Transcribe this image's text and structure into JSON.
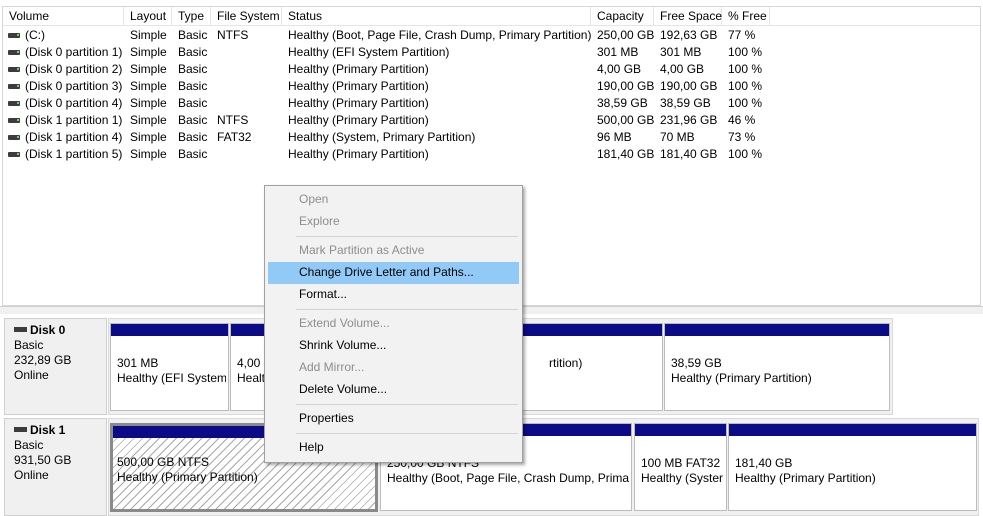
{
  "columns": [
    "Volume",
    "Layout",
    "Type",
    "File System",
    "Status",
    "Capacity",
    "Free Space",
    "% Free"
  ],
  "volumes": [
    {
      "volume": "(C:)",
      "layout": "Simple",
      "type": "Basic",
      "fs": "NTFS",
      "status": "Healthy (Boot, Page File, Crash Dump, Primary Partition)",
      "capacity": "250,00 GB",
      "free": "192,63 GB",
      "pct": "77 %"
    },
    {
      "volume": "(Disk 0 partition 1)",
      "layout": "Simple",
      "type": "Basic",
      "fs": "",
      "status": "Healthy (EFI System Partition)",
      "capacity": "301 MB",
      "free": "301 MB",
      "pct": "100 %"
    },
    {
      "volume": "(Disk 0 partition 2)",
      "layout": "Simple",
      "type": "Basic",
      "fs": "",
      "status": "Healthy (Primary Partition)",
      "capacity": "4,00 GB",
      "free": "4,00 GB",
      "pct": "100 %"
    },
    {
      "volume": "(Disk 0 partition 3)",
      "layout": "Simple",
      "type": "Basic",
      "fs": "",
      "status": "Healthy (Primary Partition)",
      "capacity": "190,00 GB",
      "free": "190,00 GB",
      "pct": "100 %"
    },
    {
      "volume": "(Disk 0 partition 4)",
      "layout": "Simple",
      "type": "Basic",
      "fs": "",
      "status": "Healthy (Primary Partition)",
      "capacity": "38,59 GB",
      "free": "38,59 GB",
      "pct": "100 %"
    },
    {
      "volume": "(Disk 1 partition 1)",
      "layout": "Simple",
      "type": "Basic",
      "fs": "NTFS",
      "status": "Healthy (Primary Partition)",
      "capacity": "500,00 GB",
      "free": "231,96 GB",
      "pct": "46 %"
    },
    {
      "volume": "(Disk 1 partition 4)",
      "layout": "Simple",
      "type": "Basic",
      "fs": "FAT32",
      "status": "Healthy (System, Primary Partition)",
      "capacity": "96 MB",
      "free": "70 MB",
      "pct": "73 %"
    },
    {
      "volume": "(Disk 1 partition 5)",
      "layout": "Simple",
      "type": "Basic",
      "fs": "",
      "status": "Healthy (Primary Partition)",
      "capacity": "181,40 GB",
      "free": "181,40 GB",
      "pct": "100 %"
    }
  ],
  "disks": [
    {
      "name": "Disk 0",
      "kind": "Basic",
      "size": "232,89 GB",
      "state": "Online",
      "partitions": [
        {
          "l1": "301 MB",
          "l2": "Healthy (EFI System"
        },
        {
          "l1": "4,00 G",
          "l2": "Healt"
        },
        {
          "l1": "",
          "l2": "rtition)"
        },
        {
          "l1": "38,59 GB",
          "l2": "Healthy (Primary Partition)"
        }
      ]
    },
    {
      "name": "Disk 1",
      "kind": "Basic",
      "size": "931,50 GB",
      "state": "Online",
      "partitions": [
        {
          "l1": "500,00 GB NTFS",
          "l2": "Healthy (Primary Partition)"
        },
        {
          "l1": "250,00 GB NTFS",
          "l2": "Healthy (Boot, Page File, Crash Dump, Primar"
        },
        {
          "l1": "100 MB FAT32",
          "l2": "Healthy (Syster"
        },
        {
          "l1": "181,40 GB",
          "l2": "Healthy (Primary Partition)"
        }
      ]
    }
  ],
  "context_menu": {
    "open": "Open",
    "explore": "Explore",
    "mark_active": "Mark Partition as Active",
    "change_letter": "Change Drive Letter and Paths...",
    "format": "Format...",
    "extend": "Extend Volume...",
    "shrink": "Shrink Volume...",
    "add_mirror": "Add Mirror...",
    "delete": "Delete Volume...",
    "properties": "Properties",
    "help": "Help"
  },
  "colors": {
    "partition_bar": "#0b0b88",
    "menu_highlight": "#91c9f7",
    "disabled_text": "#8d8d8d"
  }
}
